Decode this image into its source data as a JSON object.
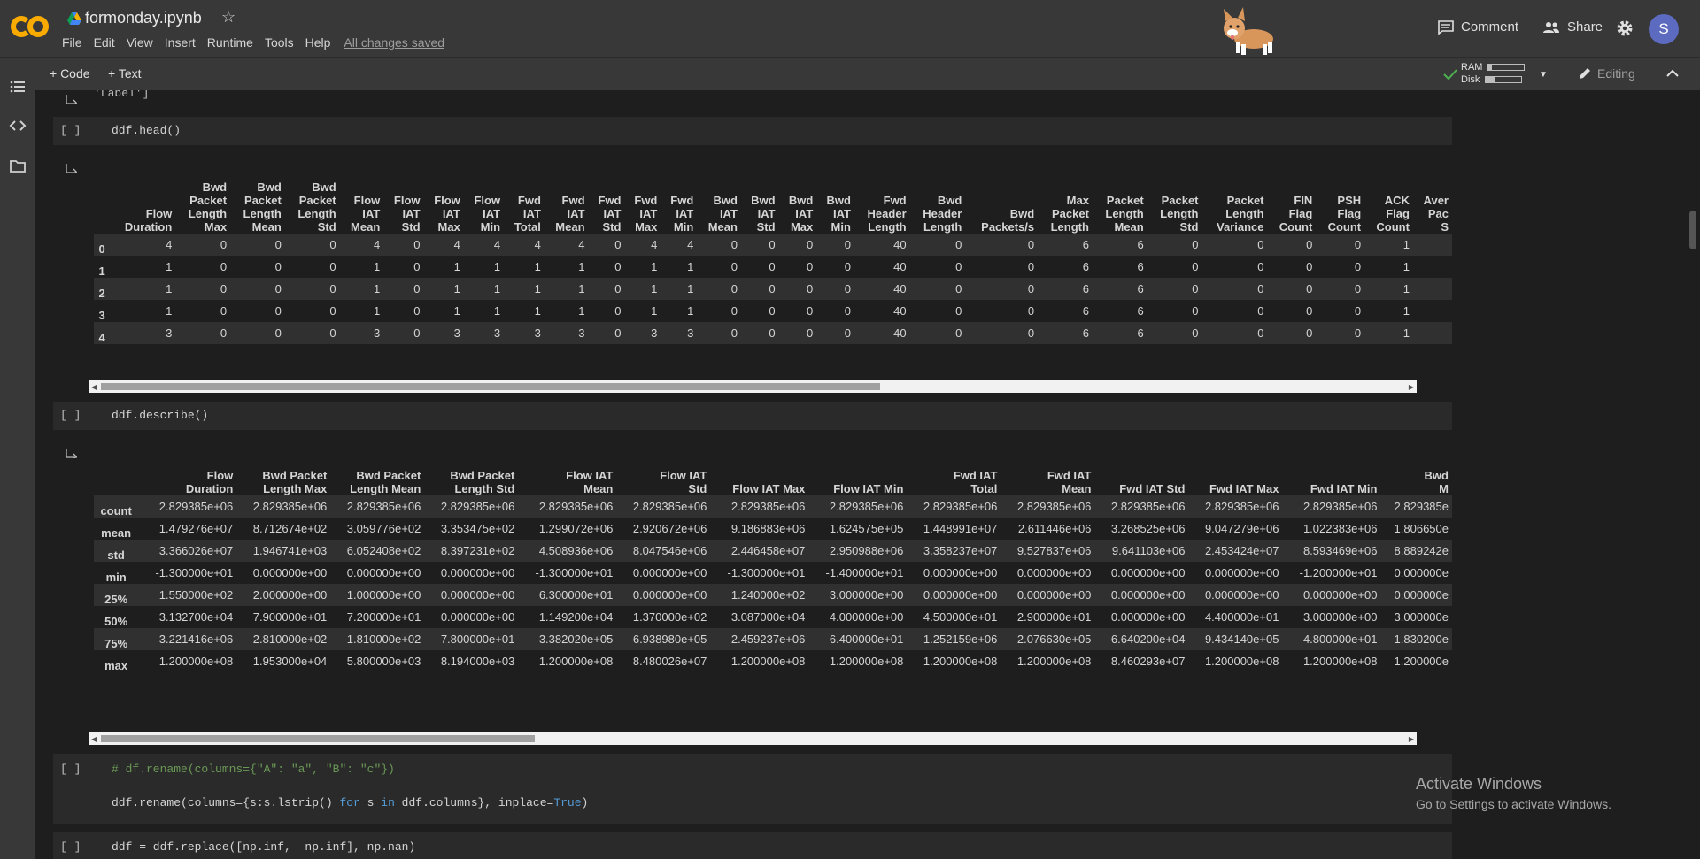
{
  "header": {
    "title": "formonday.ipynb",
    "menu": [
      "File",
      "Edit",
      "View",
      "Insert",
      "Runtime",
      "Tools",
      "Help"
    ],
    "saved_status": "All changes saved",
    "comment_label": "Comment",
    "share_label": "Share",
    "avatar_letter": "S"
  },
  "toolbar": {
    "add_code": "+ Code",
    "add_text": "+ Text",
    "ram_label": "RAM",
    "disk_label": "Disk",
    "ram_usage": 0.1,
    "disk_usage": 0.25,
    "editing_label": "Editing"
  },
  "cells": {
    "label_output": "'Label']",
    "head_code": "ddf.head()",
    "describe_code": "ddf.describe()",
    "rename_comment": "# df.rename(columns={\"A\": \"a\", \"B\": \"c\"})",
    "replace_code": "ddf = ddf.replace([np.inf, -np.inf], np.nan)",
    "bracket": "[ ]"
  },
  "head_table": {
    "columns": [
      [
        "Flow",
        "Duration"
      ],
      [
        "Bwd",
        "Packet",
        "Length",
        "Max"
      ],
      [
        "Bwd",
        "Packet",
        "Length",
        "Mean"
      ],
      [
        "Bwd",
        "Packet",
        "Length",
        "Std"
      ],
      [
        "Flow",
        "IAT",
        "Mean"
      ],
      [
        "Flow",
        "IAT",
        "Std"
      ],
      [
        "Flow",
        "IAT",
        "Max"
      ],
      [
        "Flow",
        "IAT",
        "Min"
      ],
      [
        "Fwd",
        "IAT",
        "Total"
      ],
      [
        "Fwd",
        "IAT",
        "Mean"
      ],
      [
        "Fwd",
        "IAT",
        "Std"
      ],
      [
        "Fwd",
        "IAT",
        "Max"
      ],
      [
        "Fwd",
        "IAT",
        "Min"
      ],
      [
        "Bwd",
        "IAT",
        "Mean"
      ],
      [
        "Bwd",
        "IAT",
        "Std"
      ],
      [
        "Bwd",
        "IAT",
        "Max"
      ],
      [
        "Bwd",
        "IAT",
        "Min"
      ],
      [
        "Fwd",
        "Header",
        "Length"
      ],
      [
        "Bwd",
        "Header",
        "Length"
      ],
      [
        "Bwd",
        "Packets/s"
      ],
      [
        "Max",
        "Packet",
        "Length"
      ],
      [
        "Packet",
        "Length",
        "Mean"
      ],
      [
        "Packet",
        "Length",
        "Std"
      ],
      [
        "Packet",
        "Length",
        "Variance"
      ],
      [
        "FIN",
        "Flag",
        "Count"
      ],
      [
        "PSH",
        "Flag",
        "Count"
      ],
      [
        "ACK",
        "Flag",
        "Count"
      ],
      [
        "Aver",
        "Pac",
        "S"
      ]
    ],
    "index": [
      "0",
      "1",
      "2",
      "3",
      "4"
    ],
    "rows": [
      [
        "4",
        "0",
        "0",
        "0",
        "4",
        "0",
        "4",
        "4",
        "4",
        "4",
        "0",
        "4",
        "4",
        "0",
        "0",
        "0",
        "0",
        "40",
        "0",
        "0",
        "6",
        "6",
        "0",
        "0",
        "0",
        "0",
        "1",
        ""
      ],
      [
        "1",
        "0",
        "0",
        "0",
        "1",
        "0",
        "1",
        "1",
        "1",
        "1",
        "0",
        "1",
        "1",
        "0",
        "0",
        "0",
        "0",
        "40",
        "0",
        "0",
        "6",
        "6",
        "0",
        "0",
        "0",
        "0",
        "1",
        ""
      ],
      [
        "1",
        "0",
        "0",
        "0",
        "1",
        "0",
        "1",
        "1",
        "1",
        "1",
        "0",
        "1",
        "1",
        "0",
        "0",
        "0",
        "0",
        "40",
        "0",
        "0",
        "6",
        "6",
        "0",
        "0",
        "0",
        "0",
        "1",
        ""
      ],
      [
        "1",
        "0",
        "0",
        "0",
        "1",
        "0",
        "1",
        "1",
        "1",
        "1",
        "0",
        "1",
        "1",
        "0",
        "0",
        "0",
        "0",
        "40",
        "0",
        "0",
        "6",
        "6",
        "0",
        "0",
        "0",
        "0",
        "1",
        ""
      ],
      [
        "3",
        "0",
        "0",
        "0",
        "3",
        "0",
        "3",
        "3",
        "3",
        "3",
        "0",
        "3",
        "3",
        "0",
        "0",
        "0",
        "0",
        "40",
        "0",
        "0",
        "6",
        "6",
        "0",
        "0",
        "0",
        "0",
        "1",
        ""
      ]
    ]
  },
  "describe_table": {
    "columns": [
      [
        "Flow",
        "Duration"
      ],
      [
        "Bwd Packet",
        "Length Max"
      ],
      [
        "Bwd Packet",
        "Length Mean"
      ],
      [
        "Bwd Packet",
        "Length Std"
      ],
      [
        "Flow IAT",
        "Mean"
      ],
      [
        "Flow IAT",
        "Std"
      ],
      [
        "Flow IAT Max"
      ],
      [
        "Flow IAT Min"
      ],
      [
        "Fwd IAT",
        "Total"
      ],
      [
        "Fwd IAT",
        "Mean"
      ],
      [
        "Fwd IAT Std"
      ],
      [
        "Fwd IAT Max"
      ],
      [
        "Fwd IAT Min"
      ],
      [
        "Bwd",
        "M"
      ]
    ],
    "index": [
      "count",
      "mean",
      "std",
      "min",
      "25%",
      "50%",
      "75%",
      "max"
    ],
    "rows": [
      [
        "2.829385e+06",
        "2.829385e+06",
        "2.829385e+06",
        "2.829385e+06",
        "2.829385e+06",
        "2.829385e+06",
        "2.829385e+06",
        "2.829385e+06",
        "2.829385e+06",
        "2.829385e+06",
        "2.829385e+06",
        "2.829385e+06",
        "2.829385e+06",
        "2.829385e"
      ],
      [
        "1.479276e+07",
        "8.712674e+02",
        "3.059776e+02",
        "3.353475e+02",
        "1.299072e+06",
        "2.920672e+06",
        "9.186883e+06",
        "1.624575e+05",
        "1.448991e+07",
        "2.611446e+06",
        "3.268525e+06",
        "9.047279e+06",
        "1.022383e+06",
        "1.806650e"
      ],
      [
        "3.366026e+07",
        "1.946741e+03",
        "6.052408e+02",
        "8.397231e+02",
        "4.508936e+06",
        "8.047546e+06",
        "2.446458e+07",
        "2.950988e+06",
        "3.358237e+07",
        "9.527837e+06",
        "9.641103e+06",
        "2.453424e+07",
        "8.593469e+06",
        "8.889242e"
      ],
      [
        "-1.300000e+01",
        "0.000000e+00",
        "0.000000e+00",
        "0.000000e+00",
        "-1.300000e+01",
        "0.000000e+00",
        "-1.300000e+01",
        "-1.400000e+01",
        "0.000000e+00",
        "0.000000e+00",
        "0.000000e+00",
        "0.000000e+00",
        "-1.200000e+01",
        "0.000000e"
      ],
      [
        "1.550000e+02",
        "2.000000e+00",
        "1.000000e+00",
        "0.000000e+00",
        "6.300000e+01",
        "0.000000e+00",
        "1.240000e+02",
        "3.000000e+00",
        "0.000000e+00",
        "0.000000e+00",
        "0.000000e+00",
        "0.000000e+00",
        "0.000000e+00",
        "0.000000e"
      ],
      [
        "3.132700e+04",
        "7.900000e+01",
        "7.200000e+01",
        "0.000000e+00",
        "1.149200e+04",
        "1.370000e+02",
        "3.087000e+04",
        "4.000000e+00",
        "4.500000e+01",
        "2.900000e+01",
        "0.000000e+00",
        "4.400000e+01",
        "3.000000e+00",
        "3.000000e"
      ],
      [
        "3.221416e+06",
        "2.810000e+02",
        "1.810000e+02",
        "7.800000e+01",
        "3.382020e+05",
        "6.938980e+05",
        "2.459237e+06",
        "6.400000e+01",
        "1.252159e+06",
        "2.076630e+05",
        "6.640200e+04",
        "9.434140e+05",
        "4.800000e+01",
        "1.830200e"
      ],
      [
        "1.200000e+08",
        "1.953000e+04",
        "5.800000e+03",
        "8.194000e+03",
        "1.200000e+08",
        "8.480026e+07",
        "1.200000e+08",
        "1.200000e+08",
        "1.200000e+08",
        "1.200000e+08",
        "8.460293e+07",
        "1.200000e+08",
        "1.200000e+08",
        "1.200000e"
      ]
    ]
  },
  "watermark": {
    "line1": "Activate Windows",
    "line2": "Go to Settings to activate Windows."
  }
}
